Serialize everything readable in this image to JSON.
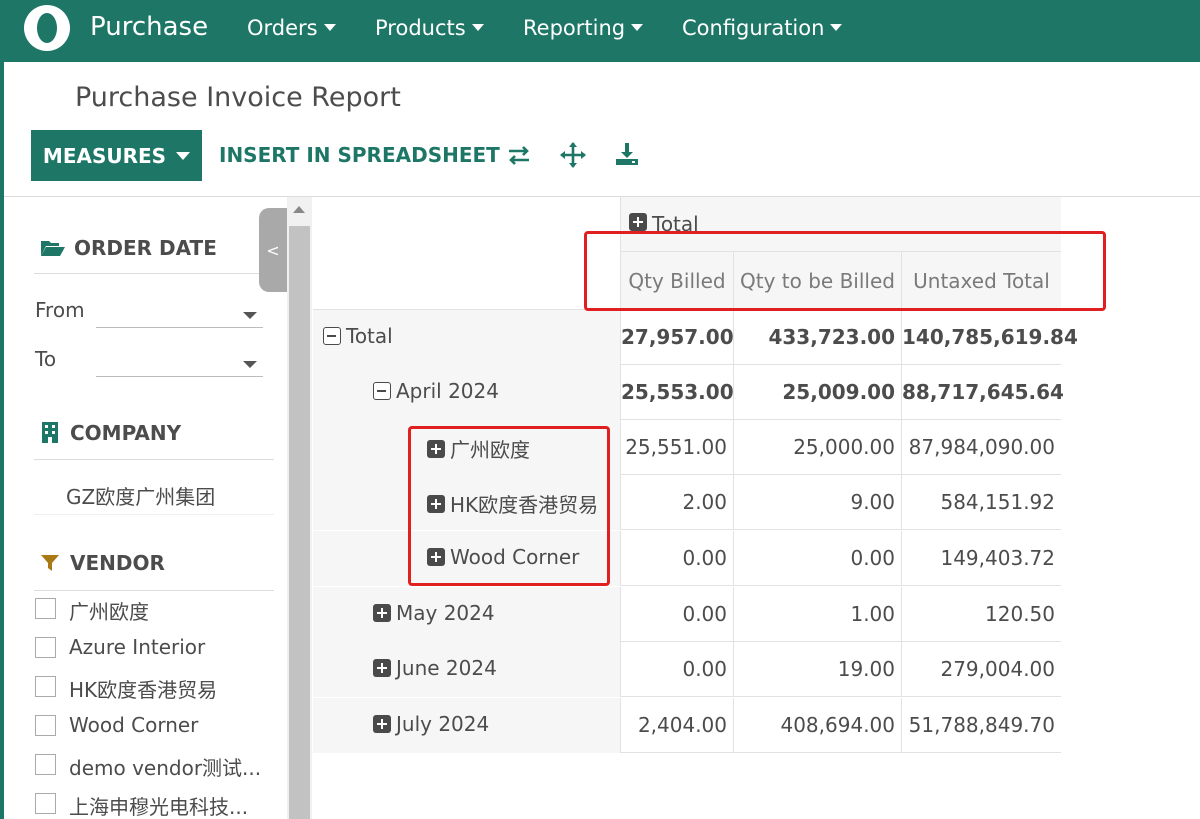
{
  "navbar": {
    "app_name": "Purchase",
    "menus": [
      "Orders",
      "Products",
      "Reporting",
      "Configuration"
    ],
    "color": "#1e7766"
  },
  "page": {
    "title": "Purchase Invoice Report"
  },
  "toolbar": {
    "measures_label": "MEASURES",
    "insert_label": "INSERT IN SPREADSHEET",
    "icons": [
      "flip-axis-icon",
      "expand-all-icon",
      "download-icon"
    ]
  },
  "sidebar": {
    "order_date": {
      "title": "ORDER DATE",
      "from_label": "From",
      "to_label": "To"
    },
    "company": {
      "title": "COMPANY",
      "items": [
        "GZ欧度广州集团"
      ]
    },
    "vendor": {
      "title": "VENDOR",
      "items": [
        "广州欧度",
        "Azure Interior",
        "HK欧度香港贸易",
        "Wood Corner",
        "demo vendor测试...",
        "上海申穆光电科技..."
      ]
    },
    "collapse_label": "<"
  },
  "pivot": {
    "col_group": "Total",
    "measures": [
      "Qty Billed",
      "Qty to be Billed",
      "Untaxed Total"
    ],
    "rows": [
      {
        "label": "Total",
        "level": 0,
        "state": "expanded",
        "values": [
          "27,957.00",
          "433,723.00",
          "140,785,619.84"
        ]
      },
      {
        "label": "April 2024",
        "level": 1,
        "state": "expanded",
        "values": [
          "25,553.00",
          "25,009.00",
          "88,717,645.64"
        ]
      },
      {
        "label": "广州欧度",
        "level": 2,
        "state": "collapsed",
        "values": [
          "25,551.00",
          "25,000.00",
          "87,984,090.00"
        ]
      },
      {
        "label": "HK欧度香港贸易",
        "level": 2,
        "state": "collapsed",
        "values": [
          "2.00",
          "9.00",
          "584,151.92"
        ]
      },
      {
        "label": "Wood Corner",
        "level": 2,
        "state": "collapsed",
        "values": [
          "0.00",
          "0.00",
          "149,403.72"
        ]
      },
      {
        "label": "May 2024",
        "level": 1,
        "state": "collapsed",
        "values": [
          "0.00",
          "1.00",
          "120.50"
        ]
      },
      {
        "label": "June 2024",
        "level": 1,
        "state": "collapsed",
        "values": [
          "0.00",
          "19.00",
          "279,004.00"
        ]
      },
      {
        "label": "July 2024",
        "level": 1,
        "state": "collapsed",
        "values": [
          "2,404.00",
          "408,694.00",
          "51,788,849.70"
        ]
      }
    ]
  },
  "highlight_color": "#e02020"
}
